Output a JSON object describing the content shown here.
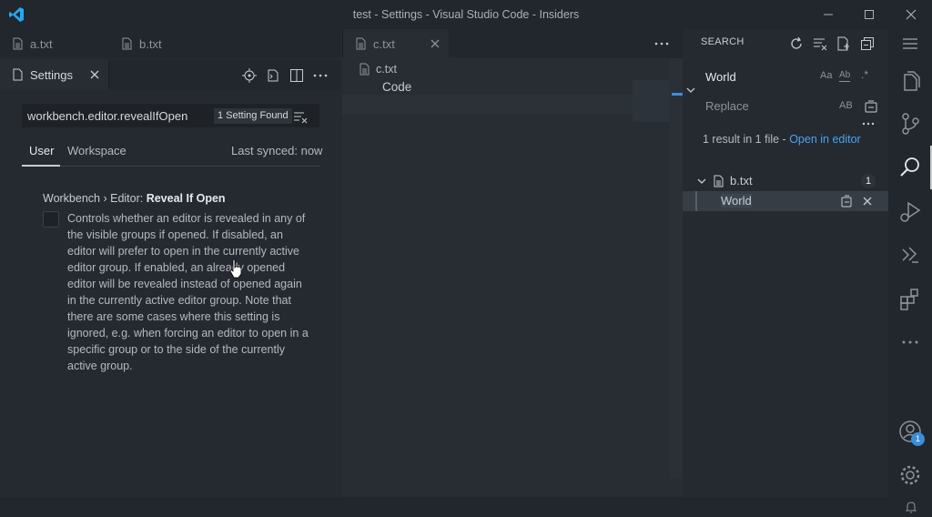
{
  "window": {
    "title": "test - Settings - Visual Studio Code - Insiders"
  },
  "left_group": {
    "tabs_row1": [
      {
        "label": "a.txt"
      },
      {
        "label": "b.txt"
      }
    ],
    "settings_tab": {
      "label": "Settings"
    },
    "search": {
      "value": "workbench.editor.revealIfOpen",
      "count": "1 Setting Found"
    },
    "scope_tabs": {
      "user": "User",
      "workspace": "Workspace"
    },
    "sync_status": "Last synced: now",
    "setting": {
      "title_prefix": "Workbench › Editor: ",
      "title_name": "Reveal If Open",
      "description": "Controls whether an editor is revealed in any of the visible groups if opened. If disabled, an editor will prefer to open in the currently active editor group. If enabled, an already opened editor will be revealed instead of opened again in the currently active editor group. Note that there are some cases where this setting is ignored, e.g. when forcing an editor to open in a specific group or to the side of the currently active group.",
      "checked": false
    }
  },
  "mid_group": {
    "tab": {
      "label": "c.txt"
    },
    "breadcrumb": "c.txt",
    "content_line": "Code"
  },
  "search_panel": {
    "header": "SEARCH",
    "search_value": "World",
    "replace_placeholder": "Replace",
    "summary_prefix": "1 result in 1 file - ",
    "summary_link": "Open in editor",
    "file": {
      "name": "b.txt",
      "count": "1"
    },
    "match": "World",
    "option_labels": {
      "case": "Aa",
      "word": "Ab",
      "regex": ".*",
      "preserve_case": "AB"
    }
  },
  "activity": {
    "accounts_badge": "1"
  },
  "colors": {
    "accent": "#3c8edb",
    "link": "#4aa3f0",
    "background": "#252a30",
    "logo": "#23a9f2"
  }
}
